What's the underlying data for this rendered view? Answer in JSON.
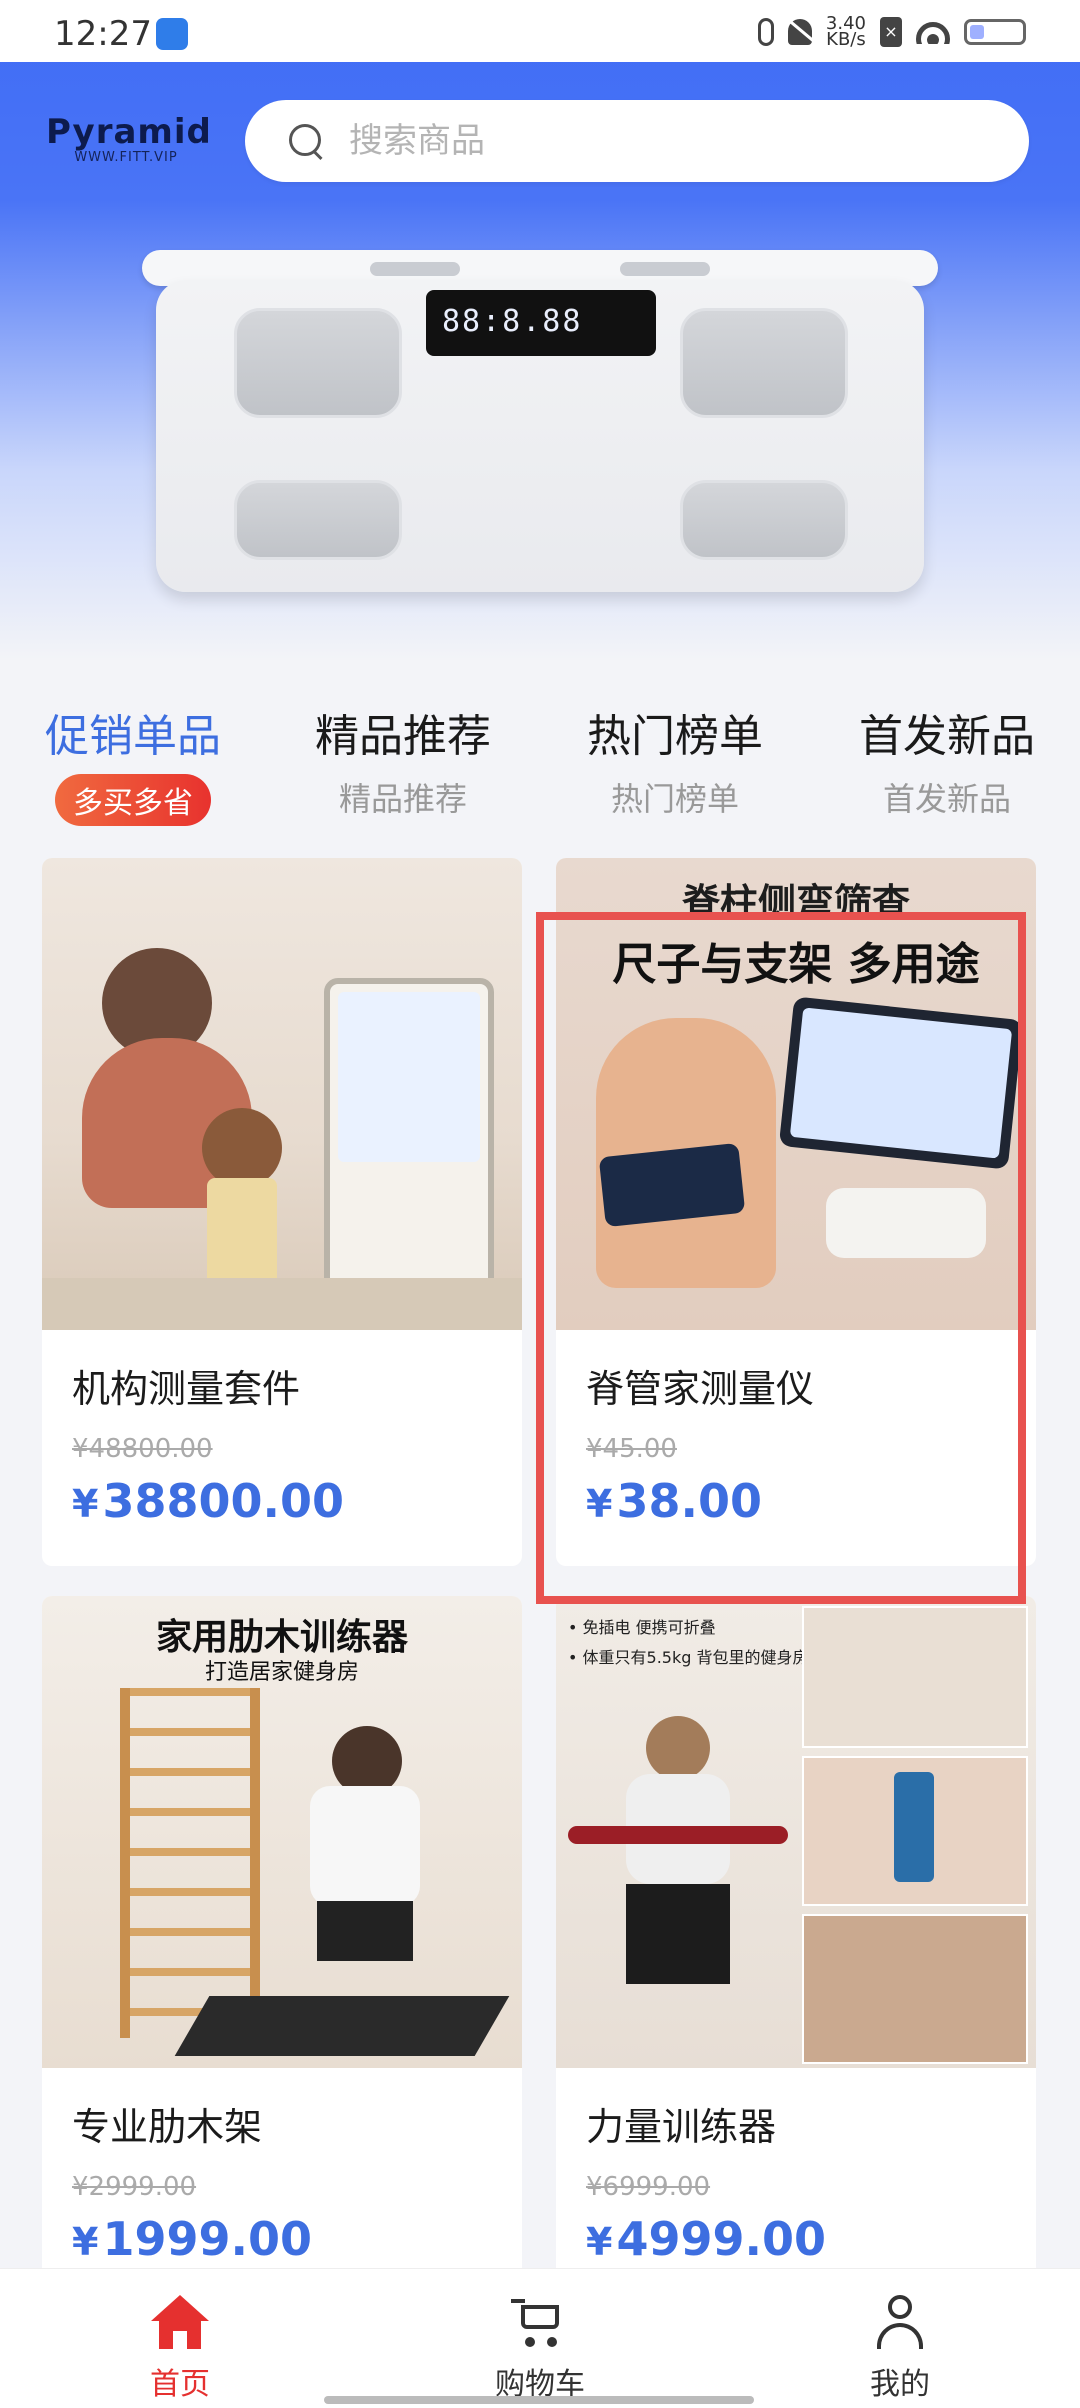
{
  "status_bar": {
    "time": "12:27",
    "net_speed_value": "3.40",
    "net_speed_unit": "KB/s",
    "battery_level": 0.2
  },
  "header": {
    "logo_title": "Pyramid",
    "logo_subtitle": "WWW.FITT.VIP",
    "search_placeholder": "搜索商品"
  },
  "banner": {
    "display_digits": "88:8.88"
  },
  "tabs": [
    {
      "title": "促销单品",
      "subtitle": "多买多省",
      "active": true
    },
    {
      "title": "精品推荐",
      "subtitle": "精品推荐",
      "active": false
    },
    {
      "title": "热门榜单",
      "subtitle": "热门榜单",
      "active": false
    },
    {
      "title": "首发新品",
      "subtitle": "首发新品",
      "active": false
    }
  ],
  "products": [
    {
      "name": "机构测量套件",
      "old_price": "¥48800.00",
      "price_symbol": "¥",
      "price": "38800.00",
      "image_text": ""
    },
    {
      "name": "脊管家测量仪",
      "old_price": "¥45.00",
      "price_symbol": "¥",
      "price": "38.00",
      "image_text": "脊柱侧弯筛查",
      "image_text2": "尺子与支架 多用途"
    },
    {
      "name": "专业肋木架",
      "old_price": "¥2999.00",
      "price_symbol": "¥",
      "price": "1999.00",
      "image_text": "家用肋木训练器",
      "image_text2": "打造居家健身房"
    },
    {
      "name": "力量训练器",
      "old_price": "¥6999.00",
      "price_symbol": "¥",
      "price": "4999.00",
      "image_text": "• 免插电 便携可折叠",
      "image_text2": "• 体重只有5.5kg 背包里的健身房"
    }
  ],
  "bottom_nav": [
    {
      "label": "首页",
      "icon": "home-icon",
      "active": true
    },
    {
      "label": "购物车",
      "icon": "cart-icon",
      "active": false
    },
    {
      "label": "我的",
      "icon": "user-icon",
      "active": false
    }
  ],
  "colors": {
    "accent": "#3d6ee0",
    "header_blue": "#3f6cf5",
    "badge_red": "#e8322e",
    "nav_active": "#e5302f",
    "highlight": "#e8524f"
  }
}
